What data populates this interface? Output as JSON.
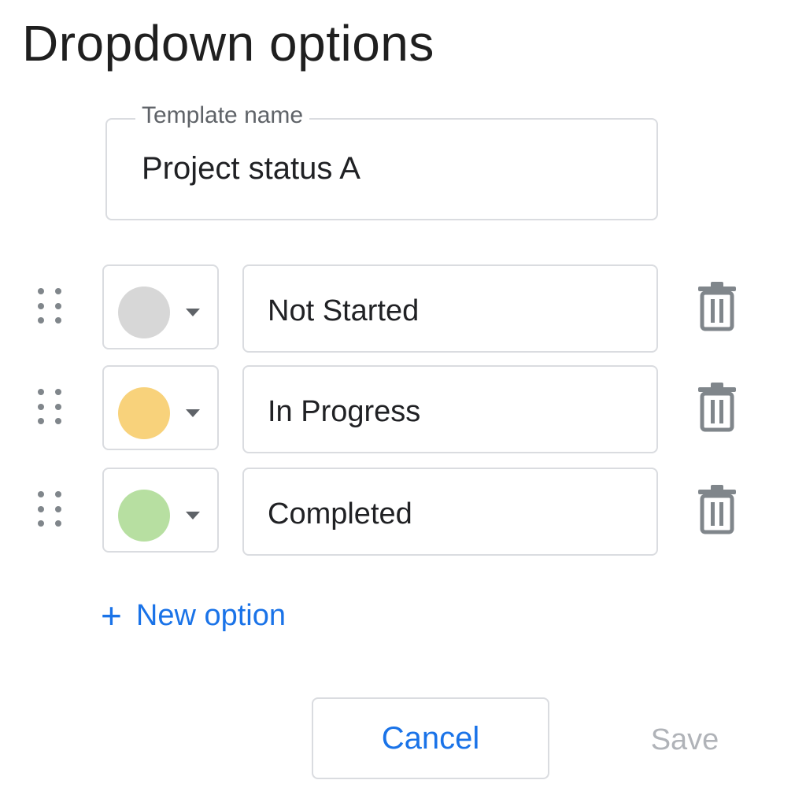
{
  "dialog": {
    "title": "Dropdown options"
  },
  "template": {
    "label": "Template name",
    "value": "Project status A"
  },
  "options": [
    {
      "label": "Not Started",
      "color": "#d7d7d7"
    },
    {
      "label": "In Progress",
      "color": "#f8d27b"
    },
    {
      "label": "Completed",
      "color": "#b7dfa1"
    }
  ],
  "icons": {
    "drag": "drag-handle-icon",
    "caret": "chevron-down-icon",
    "delete": "trash-icon",
    "add": "plus-icon"
  },
  "new_option": {
    "plus": "+",
    "label": "New option"
  },
  "footer": {
    "cancel_label": "Cancel",
    "save_label": "Save"
  },
  "colors": {
    "accent": "#1a73e8",
    "border": "#dadce0",
    "disabled": "#b0b3b8"
  }
}
